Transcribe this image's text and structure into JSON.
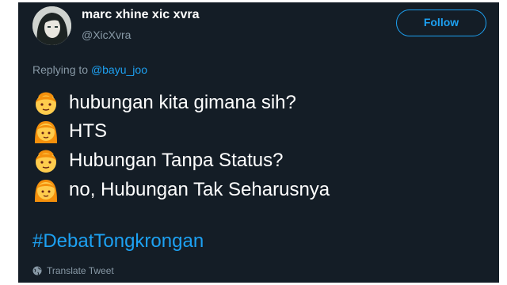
{
  "user": {
    "display_name": "marc xhine xic xvra",
    "handle": "@XicXvra",
    "follow_label": "Follow"
  },
  "reply": {
    "prefix": "Replying to",
    "mention": "@bayu_joo"
  },
  "lines": [
    {
      "emoji": "boy-emoji",
      "text": "hubungan kita gimana sih?"
    },
    {
      "emoji": "girl-emoji",
      "text": "HTS"
    },
    {
      "emoji": "boy-emoji",
      "text": "Hubungan Tanpa Status?"
    },
    {
      "emoji": "girl-emoji",
      "text": "no, Hubungan Tak Seharusnya"
    }
  ],
  "hashtag": "#DebatTongkrongan",
  "translate_label": "Translate Tweet",
  "colors": {
    "background": "#141d26",
    "accent": "#1da1f2",
    "secondary_text": "#8899a6"
  }
}
